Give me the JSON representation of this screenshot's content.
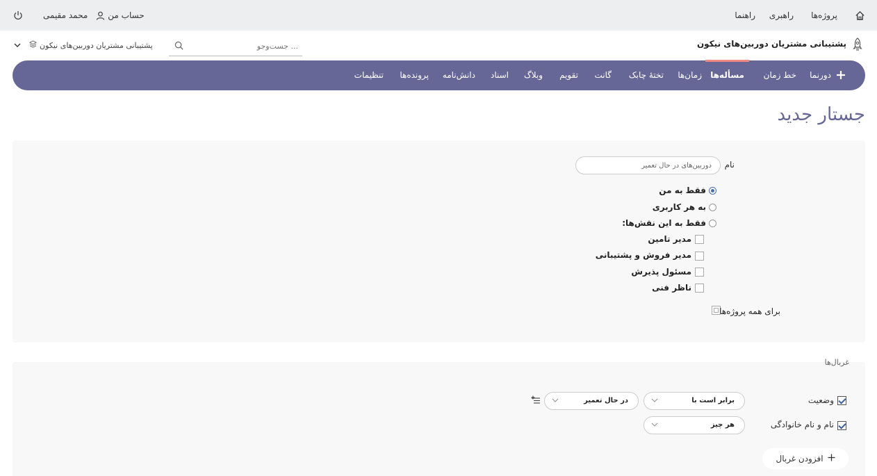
{
  "topbar": {
    "home_icon": "home-icon",
    "projects": "پروژه‌ها",
    "admin": "راهبری",
    "help": "راهنما",
    "user_name": "محمد مقیمی",
    "my_account": "حساب من",
    "power_icon": "power-icon"
  },
  "header": {
    "project_title": "پشتیبانی مشتریان دوربین‌های نیکون",
    "search_placeholder": "... جست‌وجو",
    "project_selector": "پشتیبانی مشتریان دوربین‌های نیکون"
  },
  "nav": {
    "tabs": [
      "دورنما",
      "خط زمان",
      "مسأله‌ها",
      "زمان‌ها",
      "تختهٔ چابک",
      "گانت",
      "تقویم",
      "وبلاگ",
      "اسناد",
      "دانش‌نامه",
      "پرونده‌ها",
      "تنظیمات"
    ],
    "active_tab": "مسأله‌ها",
    "accent_color": "#676797",
    "active_underline_color": "#f08a80"
  },
  "page": {
    "title": "جستار جدید"
  },
  "form": {
    "name_label": "نام",
    "name_value": "دوربین‌های در حال تعمیر",
    "visibility": {
      "only_me": "فقط به من",
      "any_user": "به هر کاربری",
      "roles_only": "فقط به این نقش‌ها:",
      "selected": "only_me"
    },
    "roles": [
      "مدیر تامین",
      "مدیر فروش و پشتیبانی",
      "مسئول پذیرش",
      "ناظر فنی"
    ],
    "all_projects_label": "برای همه پروژه‌ها"
  },
  "filters": {
    "title": "غربال‌ها",
    "rows": [
      {
        "field": "وضعیت",
        "checked": true,
        "operator": "برابر است با",
        "value": "در حال تعمیر"
      },
      {
        "field": "نام و نام خانوادگی",
        "checked": true,
        "operator": "هر چیز"
      }
    ],
    "add_filter_label": "افزودن غربال"
  }
}
